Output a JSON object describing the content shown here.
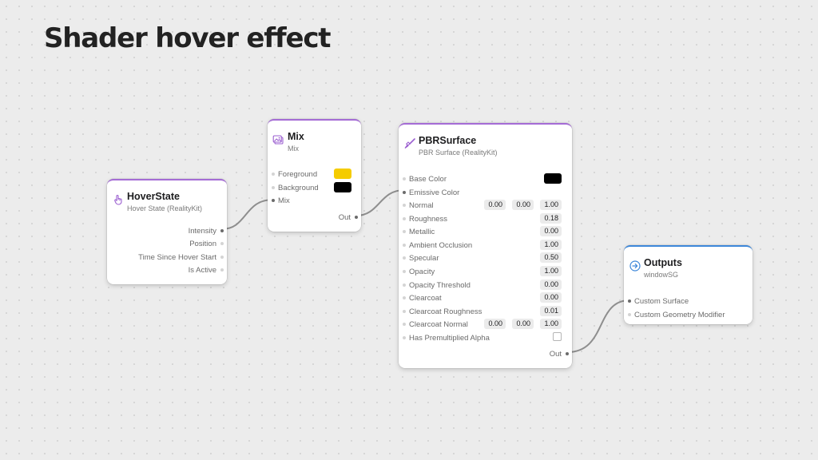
{
  "page": {
    "title": "Shader hover effect"
  },
  "colors": {
    "accent_purple": "#a56cd6",
    "accent_blue": "#3d87d9",
    "swatch_yellow": "#f5cc00",
    "swatch_black": "#000000"
  },
  "hover_node": {
    "name": "HoverState",
    "subtitle": "Hover State (RealityKit)",
    "icon": "hand-pointer-icon",
    "outputs": [
      "Intensity",
      "Position",
      "Time Since Hover Start",
      "Is Active"
    ]
  },
  "mix_node": {
    "name": "Mix",
    "subtitle": "Mix",
    "icon": "photo-stack-icon",
    "inputs": [
      "Foreground",
      "Background",
      "Mix"
    ],
    "output": "Out"
  },
  "pbr_node": {
    "name": "PBRSurface",
    "subtitle": "PBR Surface (RealityKit)",
    "icon": "paintbrush-icon",
    "inputs": {
      "base_color": "Base Color",
      "emissive_color": "Emissive Color",
      "normal": {
        "label": "Normal",
        "x": "0.00",
        "y": "0.00",
        "z": "1.00"
      },
      "roughness": {
        "label": "Roughness",
        "value": "0.18"
      },
      "metallic": {
        "label": "Metallic",
        "value": "0.00"
      },
      "ambient_occlusion": {
        "label": "Ambient Occlusion",
        "value": "1.00"
      },
      "specular": {
        "label": "Specular",
        "value": "0.50"
      },
      "opacity": {
        "label": "Opacity",
        "value": "1.00"
      },
      "opacity_threshold": {
        "label": "Opacity Threshold",
        "value": "0.00"
      },
      "clearcoat": {
        "label": "Clearcoat",
        "value": "0.00"
      },
      "clearcoat_roughness": {
        "label": "Clearcoat Roughness",
        "value": "0.01"
      },
      "clearcoat_normal": {
        "label": "Clearcoat Normal",
        "x": "0.00",
        "y": "0.00",
        "z": "1.00"
      },
      "premultiplied": {
        "label": "Has Premultiplied Alpha",
        "checked": false
      }
    },
    "output": "Out"
  },
  "outputs_node": {
    "name": "Outputs",
    "subtitle": "windowSG",
    "icon": "arrow-circle-icon",
    "inputs": [
      "Custom Surface",
      "Custom Geometry Modifier"
    ]
  }
}
